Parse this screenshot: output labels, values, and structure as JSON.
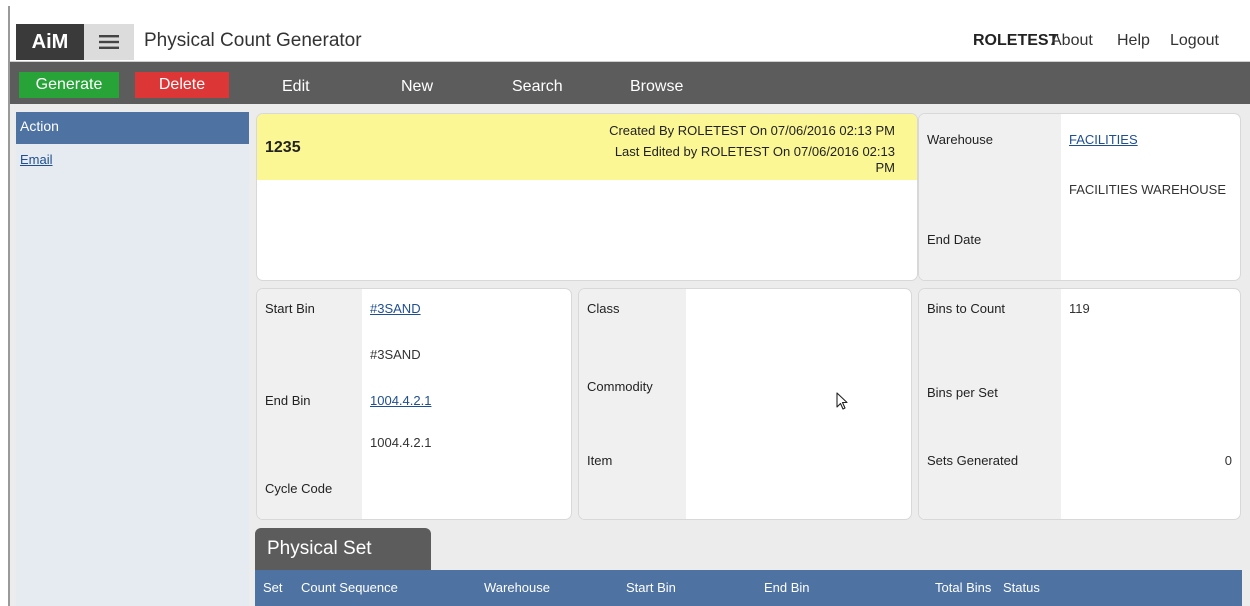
{
  "header": {
    "logo": "AiM",
    "title": "Physical Count Generator",
    "user": "ROLETEST",
    "links": [
      "About",
      "Help",
      "Logout"
    ]
  },
  "toolbar": {
    "generate_label": "Generate",
    "delete_label": "Delete",
    "items": [
      "Edit",
      "New",
      "Search",
      "Browse"
    ]
  },
  "sidebar": {
    "heading": "Action",
    "items": [
      "Email"
    ]
  },
  "record": {
    "id": "1235",
    "created": "Created By ROLETEST On 07/06/2016 02:13 PM",
    "edited_line1": "Last Edited by ROLETEST On 07/06/2016 02:13",
    "edited_line2": "PM"
  },
  "warehouse": {
    "label": "Warehouse",
    "code": "FACILITIES",
    "description": "FACILITIES WAREHOUSE",
    "end_date_label": "End Date"
  },
  "bins": {
    "start_label": "Start Bin",
    "start_link": "#3SAND",
    "start_desc": "#3SAND",
    "end_label": "End Bin",
    "end_link": "1004.4.2.1",
    "end_desc": "1004.4.2.1",
    "cycle_label": "Cycle Code"
  },
  "classification": {
    "class_label": "Class",
    "commodity_label": "Commodity",
    "item_label": "Item"
  },
  "counts": {
    "bins_to_count_label": "Bins to Count",
    "bins_to_count": "119",
    "bins_per_set_label": "Bins per Set",
    "sets_generated_label": "Sets Generated",
    "sets_generated": "0"
  },
  "physical_set": {
    "tab_label": "Physical Set",
    "columns": [
      "Set",
      "Count Sequence",
      "Warehouse",
      "Start Bin",
      "End Bin",
      "Total Bins",
      "Status"
    ]
  },
  "colors": {
    "generate": "#27a338",
    "delete": "#dd3636",
    "toolbar": "#5c5c5c",
    "accent_blue": "#4e73a2",
    "highlight": "#fbf794"
  }
}
